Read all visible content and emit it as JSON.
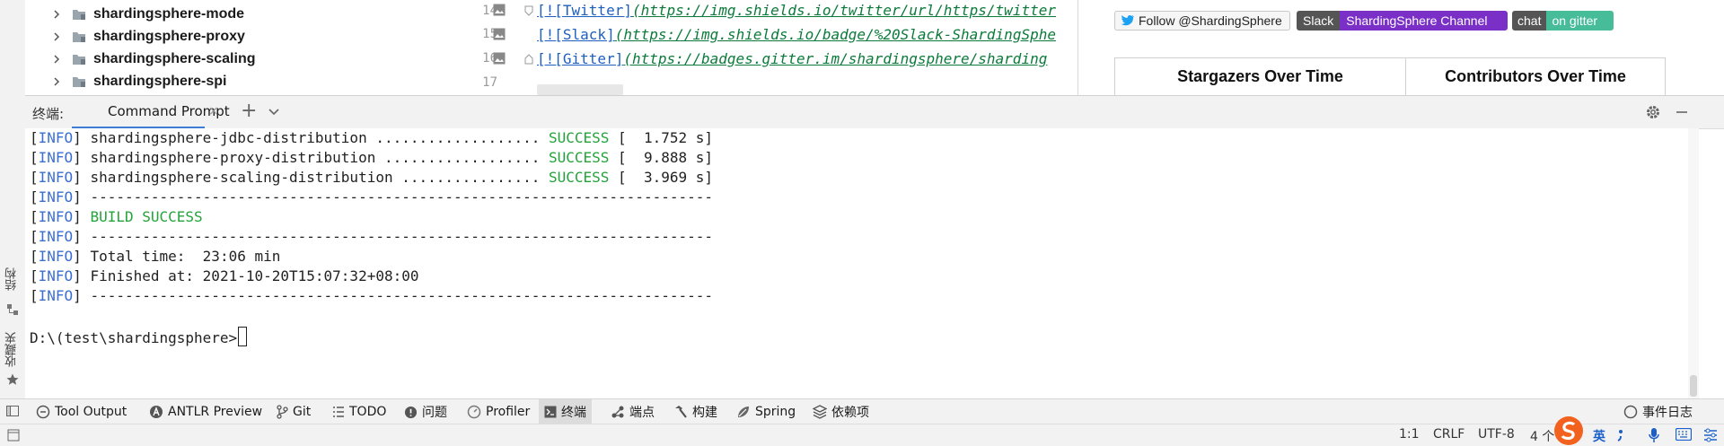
{
  "project_tree": {
    "items": [
      {
        "label": "shardingsphere-mode"
      },
      {
        "label": "shardingsphere-proxy"
      },
      {
        "label": "shardingsphere-scaling"
      },
      {
        "label": "shardingsphere-spi"
      }
    ]
  },
  "editor": {
    "lines": [
      {
        "num": "14",
        "link_text": "[![Twitter]",
        "url": "(https://img.shields.io/twitter/url/https/twitter"
      },
      {
        "num": "15",
        "link_text": "[![Slack]",
        "url": "(https://img.shields.io/badge/%20Slack-ShardingSphe"
      },
      {
        "num": "16",
        "link_text": "[![Gitter]",
        "url": "(https://badges.gitter.im/shardingsphere/sharding"
      },
      {
        "num": "17",
        "link_text": "",
        "url": ""
      }
    ]
  },
  "preview": {
    "twitter_badge": "Follow @ShardingSphere",
    "slack_badge_left": "Slack",
    "slack_badge_right": "ShardingSphere Channel",
    "chat_badge_left": "chat",
    "chat_badge_right": "on gitter",
    "stats_headers": [
      "Stargazers Over Time",
      "Contributors Over Time"
    ]
  },
  "terminal": {
    "title": "终端:",
    "tab_label": "Command Prompt",
    "tab_close": "×",
    "add": "+",
    "info_tag": "INFO",
    "lines": [
      {
        "text": " shardingsphere-jdbc-distribution ................... ",
        "status": "SUCCESS",
        "tail": " [  1.752 s]"
      },
      {
        "text": " shardingsphere-proxy-distribution .................. ",
        "status": "SUCCESS",
        "tail": " [  9.888 s]"
      },
      {
        "text": " shardingsphere-scaling-distribution ................ ",
        "status": "SUCCESS",
        "tail": " [  3.969 s]"
      },
      {
        "text": " ------------------------------------------------------------------------",
        "status": "",
        "tail": ""
      },
      {
        "text": " ",
        "status": "BUILD SUCCESS",
        "tail": ""
      },
      {
        "text": " ------------------------------------------------------------------------",
        "status": "",
        "tail": ""
      },
      {
        "text": " Total time:  23:06 min",
        "status": "",
        "tail": ""
      },
      {
        "text": " Finished at: 2021-10-20T15:07:32+08:00",
        "status": "",
        "tail": ""
      },
      {
        "text": " ------------------------------------------------------------------------",
        "status": "",
        "tail": ""
      }
    ],
    "prompt": "D:\\(test\\shardingsphere>"
  },
  "left_strip": {
    "structure_label": "结构",
    "favorites_label": "收藏夹"
  },
  "tool_windows": {
    "items": [
      {
        "label": "Tool Output",
        "icon": "tool-output-icon"
      },
      {
        "label": "ANTLR Preview",
        "icon": "antlr-icon"
      },
      {
        "label": "Git",
        "icon": "git-branch-icon"
      },
      {
        "label": "TODO",
        "icon": "todo-list-icon"
      },
      {
        "label": "问题",
        "icon": "problems-icon"
      },
      {
        "label": "Profiler",
        "icon": "profiler-icon"
      },
      {
        "label": "终端",
        "icon": "terminal-icon"
      },
      {
        "label": "端点",
        "icon": "endpoints-icon"
      },
      {
        "label": "构建",
        "icon": "build-hammer-icon"
      },
      {
        "label": "Spring",
        "icon": "spring-leaf-icon"
      },
      {
        "label": "依赖项",
        "icon": "dependencies-icon"
      }
    ],
    "event_log": "事件日志"
  },
  "status_bar": {
    "position": "1:1",
    "line_sep": "CRLF",
    "encoding": "UTF-8",
    "indent": "4 个",
    "ime_lang": "英"
  },
  "colors": {
    "accent": "#3d7dd6",
    "success": "#23a33a",
    "info": "#3b6fd1",
    "slack": "#7a2fc7",
    "gitter": "#46bc99"
  }
}
